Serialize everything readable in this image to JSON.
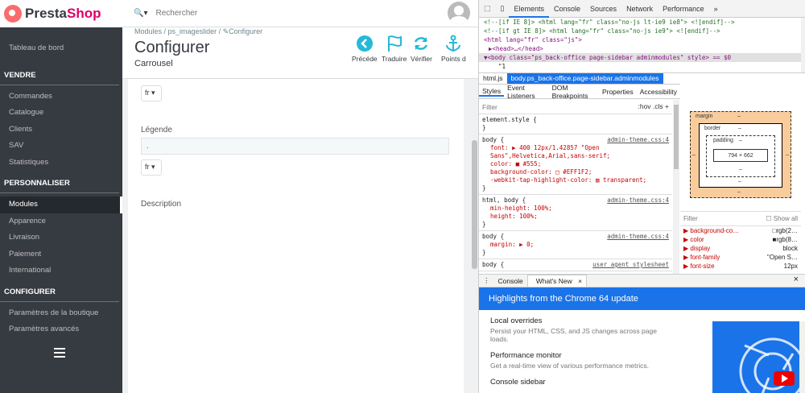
{
  "brand": {
    "name_a": "Presta",
    "name_b": "Shop"
  },
  "search": {
    "placeholder": "Rechercher"
  },
  "sidebar": {
    "dashboard": "Tableau de bord",
    "sec_sell": "VENDRE",
    "sell": [
      "Commandes",
      "Catalogue",
      "Clients",
      "SAV",
      "Statistiques"
    ],
    "sec_custom": "PERSONNALISER",
    "custom": [
      "Modules",
      "Apparence",
      "Livraison",
      "Paiement",
      "International"
    ],
    "sec_config": "CONFIGURER",
    "config": [
      "Paramètres de la boutique",
      "Paramètres avancés"
    ]
  },
  "header": {
    "breadcrumb_1": "Modules",
    "breadcrumb_2": "ps_imageslider",
    "breadcrumb_3": "Configurer",
    "title": "Configurer",
    "subtitle": "Carrousel",
    "toolbar": [
      "Précéde",
      "Traduire",
      "Vérifier",
      "Points d"
    ]
  },
  "form": {
    "lang_1": "fr",
    "legend_label": "Légende",
    "legend_value": ".",
    "lang_2": "fr",
    "description_label": "Description"
  },
  "devtools": {
    "tabs": [
      "Elements",
      "Console",
      "Sources",
      "Network",
      "Performance",
      "»"
    ],
    "dom": [
      "<!--[if IE 8]>    <html lang=\"fr\" class=\"no-js lt-ie9 ie8\"> <![endif]-->",
      "<!--[if gt IE 8]> <html lang=\"fr\" class=\"no-js ie9\"> <![endif]-->",
      "<html lang=\"fr\" class=\"js\">",
      "▶<head>…</head>",
      "▼<body class=\"ps_back-office page-sidebar adminmodules\" style> == $0",
      "\"1"
    ],
    "crumb_1": "html.js",
    "crumb_2": "body.ps_back-office.page-sidebar.adminmodules",
    "style_tabs": [
      "Styles",
      "Event Listeners",
      "DOM Breakpoints",
      "Properties",
      "Accessibility"
    ],
    "filter_label": "Filter",
    "filter_right": ":hov  .cls  +",
    "element_style": "element.style {",
    "close_brace": "}",
    "rule1_sel": "body {",
    "rule1_src": "admin-theme.css:4",
    "rule1_font": "font: ▶ 400 12px/1.42857 \"Open Sans\",Helvetica,Arial,sans-serif;",
    "rule1_color": "color: ■ #555;",
    "rule1_bg": "background-color: □ #EFF1F2;",
    "rule1_tap": "-webkit-tap-highlight-color: ▨ transparent;",
    "rule2_sel": "html, body {",
    "rule2_src": "admin-theme.css:4",
    "rule2_a": "min-height: 100%;",
    "rule2_b": "height: 100%;",
    "rule3_sel": "body {",
    "rule3_src": "admin-theme.css:4",
    "rule3_a": "margin: ▶ 0;",
    "rule4_sel": "body {",
    "rule4_src": "user agent stylesheet",
    "box_margin": "margin",
    "box_border": "border",
    "box_padding": "padding",
    "box_dash": "–",
    "box_size": "794 × 662",
    "computed_filter": "Filter",
    "show_all": "Show all",
    "computed": [
      {
        "k": "background-co…",
        "v": "rgb(2…"
      },
      {
        "k": "color",
        "v": "rgb(8…"
      },
      {
        "k": "display",
        "v": "block"
      },
      {
        "k": "font-family",
        "v": "\"Open S…"
      },
      {
        "k": "font-size",
        "v": "12px"
      }
    ],
    "drawer_tabs": [
      "Console",
      "What's New"
    ],
    "banner": "Highlights from the Chrome 64 update",
    "news": [
      {
        "title": "Local overrides",
        "desc": "Persist your HTML, CSS, and JS changes across page loads."
      },
      {
        "title": "Performance monitor",
        "desc": "Get a real-time view of various performance metrics."
      },
      {
        "title": "Console sidebar",
        "desc": ""
      }
    ]
  },
  "colors": {
    "sidebar": "#363a41",
    "accent": "#25b9d7",
    "devtools_blue": "#1a73e8"
  }
}
